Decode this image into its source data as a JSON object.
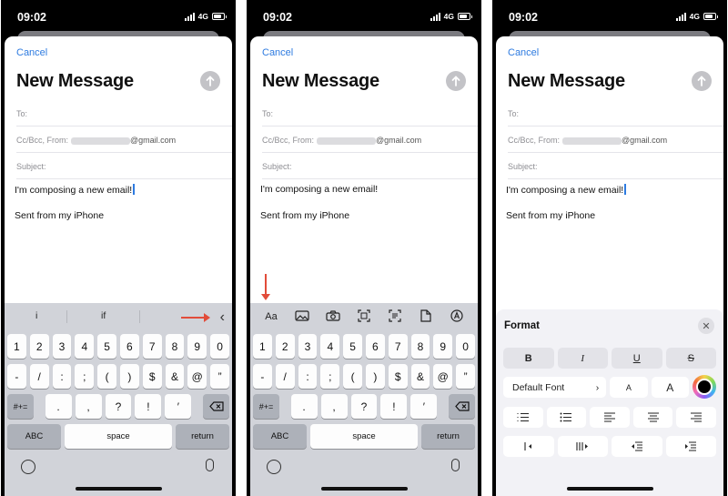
{
  "status": {
    "time": "09:02",
    "network": "4G"
  },
  "compose": {
    "cancel": "Cancel",
    "title": "New Message",
    "to_label": "To:",
    "ccbcc_label": "Cc/Bcc, From:",
    "email_domain": "@gmail.com",
    "subject_label": "Subject:",
    "body": "I'm composing a new email!",
    "signature": "Sent from my iPhone"
  },
  "keyboard": {
    "suggestions": [
      "i",
      "if"
    ],
    "row1": [
      "1",
      "2",
      "3",
      "4",
      "5",
      "6",
      "7",
      "8",
      "9",
      "0"
    ],
    "row2": [
      "-",
      "/",
      ":",
      ";",
      "(",
      ")",
      "$",
      "&",
      "@",
      "”"
    ],
    "row3": [
      ".",
      ",",
      "?",
      "!",
      "′"
    ],
    "shift_label": "#+=",
    "abc": "ABC",
    "space": "space",
    "return": "return"
  },
  "toolbar": {
    "aa": "Aa"
  },
  "format": {
    "title": "Format",
    "bold": "B",
    "italic": "I",
    "underline": "U",
    "strike": "S",
    "font": "Default Font",
    "small_a": "A",
    "large_a": "A"
  },
  "colors": {
    "accent": "#2e7be0",
    "annotation": "#e24c3a",
    "keyboard": "#d1d3d9"
  },
  "icons": [
    "send-arrow-icon",
    "chevron-left-icon",
    "photo-icon",
    "camera-icon",
    "scan-document-icon",
    "scan-text-icon",
    "file-icon",
    "markup-icon",
    "emoji-icon",
    "microphone-icon",
    "delete-icon",
    "close-icon",
    "color-picker-icon",
    "bullet-list-icon",
    "numbered-list-icon",
    "align-left-icon",
    "align-center-icon",
    "align-right-icon",
    "indent-icon",
    "outdent-icon"
  ]
}
